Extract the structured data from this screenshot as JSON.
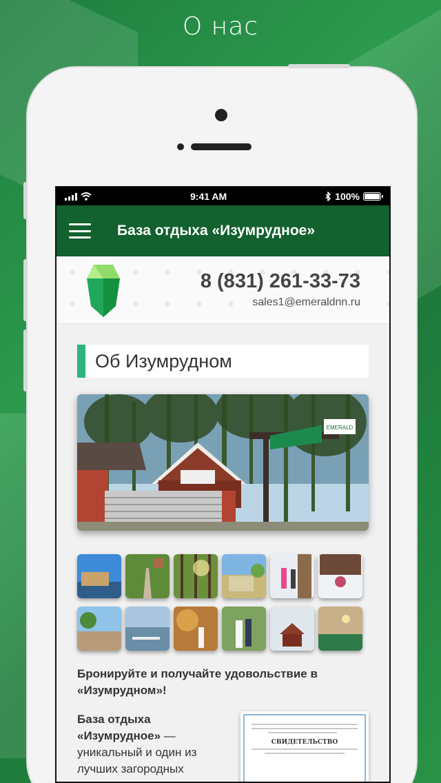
{
  "page": {
    "title": "О нас"
  },
  "status_bar": {
    "time": "9:41 AM",
    "battery": "100%"
  },
  "app_bar": {
    "title": "База отдыха «Изумрудное»"
  },
  "header": {
    "phone": "8 (831) 261-33-73",
    "email": "sales1@emeraldnn.ru"
  },
  "section": {
    "heading": "Об Изумрудном"
  },
  "hero": {
    "sign_text": "EMERALD"
  },
  "gallery": {
    "thumbnails": [
      {
        "scene": "lake-house"
      },
      {
        "scene": "forest-path"
      },
      {
        "scene": "sunny-pines"
      },
      {
        "scene": "pier-lake"
      },
      {
        "scene": "yoga-winter"
      },
      {
        "scene": "snow-sled"
      },
      {
        "scene": "park-fountain"
      },
      {
        "scene": "marina"
      },
      {
        "scene": "autumn-wedding"
      },
      {
        "scene": "wedding-couple"
      },
      {
        "scene": "winter-cabin"
      },
      {
        "scene": "banquet-hall"
      }
    ]
  },
  "tagline": "Бронируйте и получайте удовольствие в «Изумрудном»!",
  "about": {
    "name": "База отдыха «Изумрудное»",
    "text": "— уникальный и один из лучших загородных"
  },
  "certificate": {
    "title": "СВИДЕТЕЛЬСТВО"
  },
  "colors": {
    "app_bar": "#12612e",
    "accent": "#2eb380",
    "background_green": "#1f7d3e"
  }
}
